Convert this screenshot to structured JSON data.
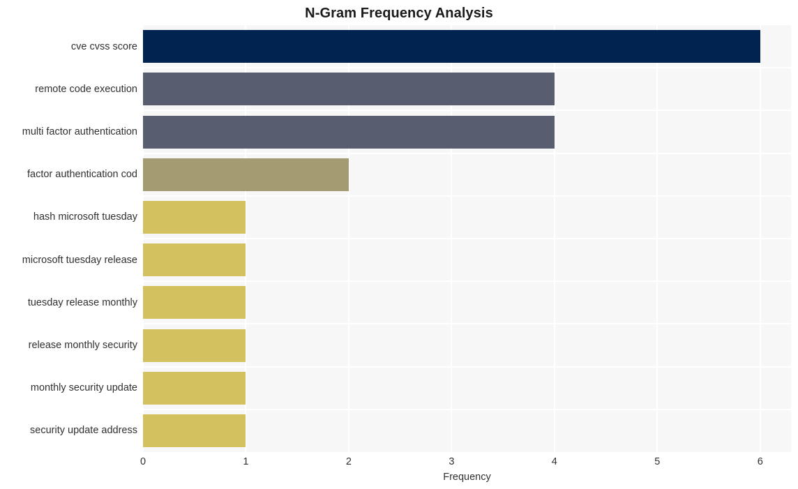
{
  "chart_data": {
    "type": "bar",
    "orientation": "horizontal",
    "title": "N-Gram Frequency Analysis",
    "xlabel": "Frequency",
    "ylabel": "",
    "xlim": [
      0,
      6.3
    ],
    "xticks": [
      "0",
      "1",
      "2",
      "3",
      "4",
      "5",
      "6"
    ],
    "xtick_values": [
      0,
      1,
      2,
      3,
      4,
      5,
      6
    ],
    "grid": true,
    "legend": "none",
    "categories": [
      "cve cvss score",
      "remote code execution",
      "multi factor authentication",
      "factor authentication cod",
      "hash microsoft tuesday",
      "microsoft tuesday release",
      "tuesday release monthly",
      "release monthly security",
      "monthly security update",
      "security update address"
    ],
    "values": [
      6,
      4,
      4,
      2,
      1,
      1,
      1,
      1,
      1,
      1
    ],
    "bar_colors": [
      "#00234f",
      "#585e70",
      "#585e70",
      "#a49b73",
      "#d2c15e",
      "#d2c15e",
      "#d2c15e",
      "#d2c15e",
      "#d2c15e",
      "#d2c15e"
    ],
    "plot_background": "#f7f7f7",
    "grid_color": "#ffffff",
    "text_color": "#303030",
    "title_color": "#1a1a1a"
  }
}
